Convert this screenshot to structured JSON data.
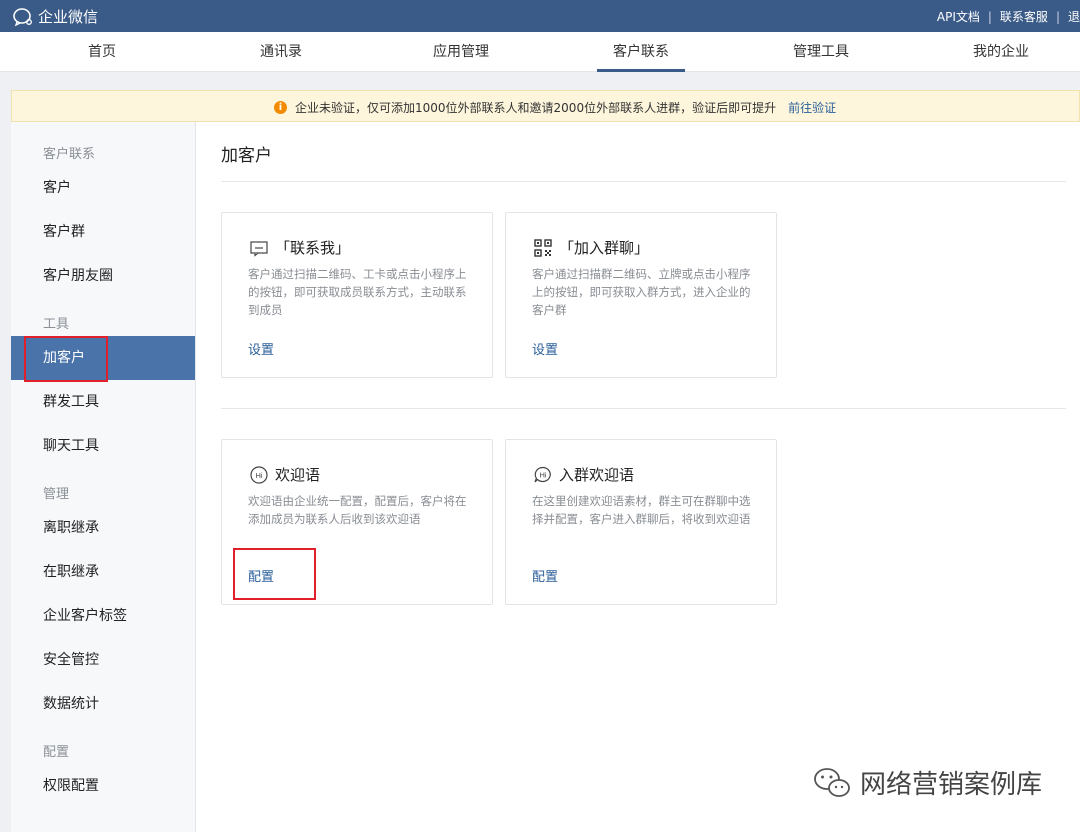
{
  "topbar": {
    "app_name": "企业微信",
    "links": [
      "API文档",
      "联系客服",
      "退"
    ]
  },
  "nav": {
    "items": [
      "首页",
      "通讯录",
      "应用管理",
      "客户联系",
      "管理工具",
      "我的企业"
    ],
    "active": "客户联系"
  },
  "notice": {
    "text": "企业未验证，仅可添加1000位外部联系人和邀请2000位外部联系人进群，验证后即可提升",
    "link": "前往验证"
  },
  "sidebar": {
    "group_customer": "客户联系",
    "customer": "客户",
    "customer_group": "客户群",
    "moments": "客户朋友圈",
    "group_tools": "工具",
    "add_customer": "加客户",
    "mass_send": "群发工具",
    "chat_tools": "聊天工具",
    "group_manage": "管理",
    "resign_inherit": "离职继承",
    "onjob_inherit": "在职继承",
    "tags": "企业客户标签",
    "security": "安全管控",
    "statistics": "数据统计",
    "group_config": "配置",
    "permission": "权限配置"
  },
  "main": {
    "title": "加客户",
    "cards": [
      {
        "icon": "message-icon",
        "title": "「联系我」",
        "desc": "客户通过扫描二维码、工卡或点击小程序上的按钮，即可获取成员联系方式，主动联系到成员",
        "action": "设置"
      },
      {
        "icon": "qrcode-icon",
        "title": "「加入群聊」",
        "desc": "客户通过扫描群二维码、立牌或点击小程序上的按钮，即可获取入群方式，进入企业的客户群",
        "action": "设置"
      },
      {
        "icon": "hi-icon",
        "title": "欢迎语",
        "desc": "欢迎语由企业统一配置，配置后，客户将在添加成员为联系人后收到该欢迎语",
        "action": "配置"
      },
      {
        "icon": "group-hi-icon",
        "title": "入群欢迎语",
        "desc": "在这里创建欢迎语素材，群主可在群聊中选择并配置，客户进入群聊后，将收到欢迎语",
        "action": "配置"
      }
    ]
  },
  "watermark": {
    "text": "网络营销案例库"
  },
  "colors": {
    "topbar": "#3a5a87",
    "active_sidebar": "#4a73aa",
    "link": "#2b5f99",
    "highlight_box": "#e2202b",
    "notice_bg": "#fdf6dc"
  }
}
